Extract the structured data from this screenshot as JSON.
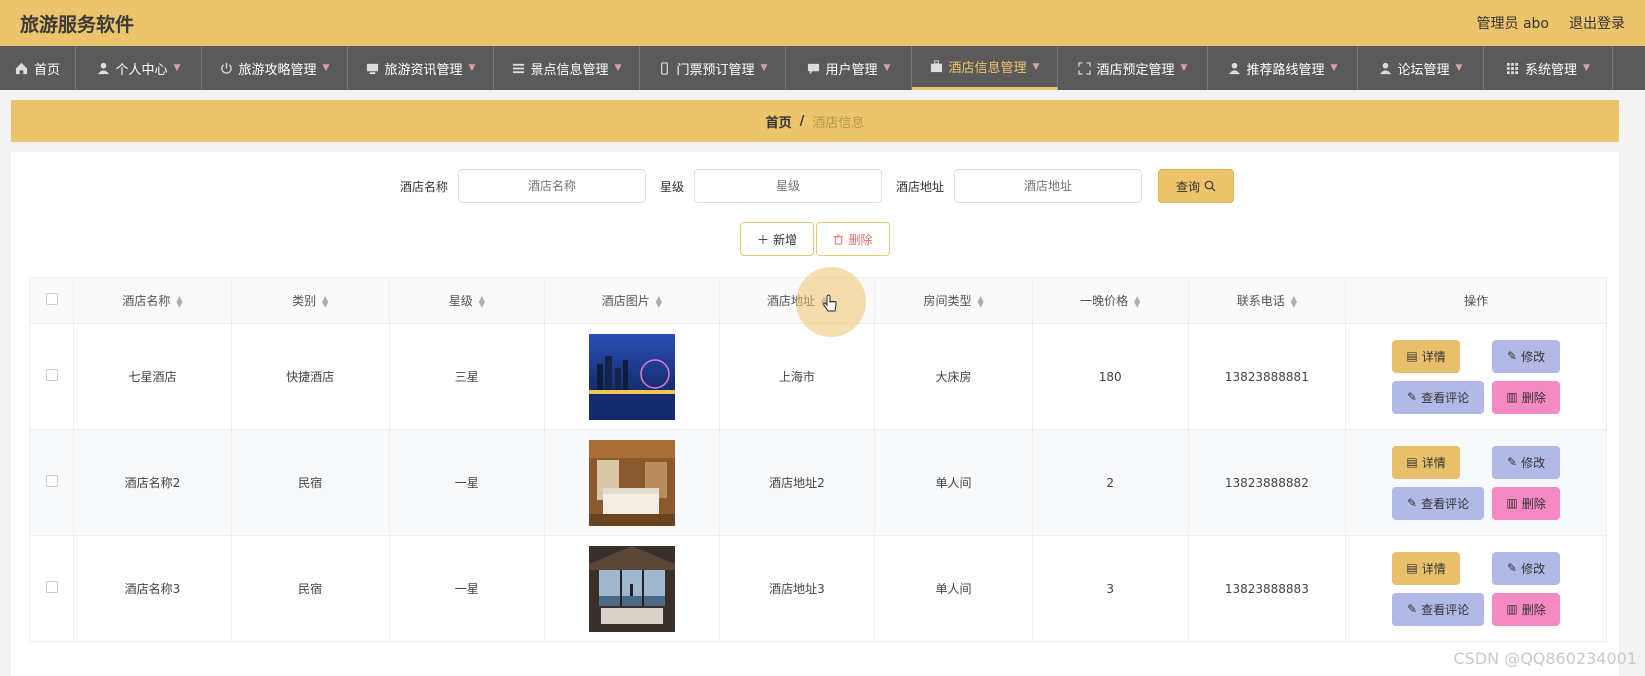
{
  "header": {
    "title": "旅游服务软件",
    "user": "管理员 abo",
    "logout": "退出登录"
  },
  "nav": [
    {
      "label": "首页",
      "icon": "home-icon",
      "width": 76
    },
    {
      "label": "个人中心",
      "icon": "user-icon",
      "width": 126
    },
    {
      "label": "旅游攻略管理",
      "icon": "power-icon",
      "width": 146
    },
    {
      "label": "旅游资讯管理",
      "icon": "monitor-icon",
      "width": 146
    },
    {
      "label": "景点信息管理",
      "icon": "list-icon",
      "width": 146
    },
    {
      "label": "门票预订管理",
      "icon": "phone-icon",
      "width": 146
    },
    {
      "label": "用户管理",
      "icon": "chat-icon",
      "width": 126
    },
    {
      "label": "酒店信息管理",
      "icon": "briefcase-icon",
      "width": 146,
      "active": true
    },
    {
      "label": "酒店预定管理",
      "icon": "fullscreen-icon",
      "width": 150
    },
    {
      "label": "推荐路线管理",
      "icon": "user-icon",
      "width": 150
    },
    {
      "label": "论坛管理",
      "icon": "user-icon",
      "width": 126
    },
    {
      "label": "系统管理",
      "icon": "grid-icon",
      "width": 129
    }
  ],
  "breadcrumb": {
    "home": "首页",
    "separator": "/",
    "current": "酒店信息"
  },
  "search": {
    "name_label": "酒店名称",
    "name_placeholder": "酒店名称",
    "star_label": "星级",
    "star_placeholder": "星级",
    "addr_label": "酒店地址",
    "addr_placeholder": "酒店地址",
    "query_label": "查询"
  },
  "toolbar": {
    "add_label": "新增",
    "delete_label": "删除"
  },
  "table": {
    "columns": [
      "酒店名称",
      "类别",
      "星级",
      "酒店图片",
      "酒店地址",
      "房间类型",
      "一晚价格",
      "联系电话",
      "操作"
    ],
    "rows": [
      {
        "name": "七星酒店",
        "type": "快捷酒店",
        "star": "三星",
        "address": "上海市",
        "room": "大床房",
        "price": "180",
        "phone": "13823888881"
      },
      {
        "name": "酒店名称2",
        "type": "民宿",
        "star": "一星",
        "address": "酒店地址2",
        "room": "单人间",
        "price": "2",
        "phone": "13823888882"
      },
      {
        "name": "酒店名称3",
        "type": "民宿",
        "star": "一星",
        "address": "酒店地址3",
        "room": "单人间",
        "price": "3",
        "phone": "13823888883"
      }
    ],
    "ops": {
      "detail": "详情",
      "edit": "修改",
      "comment": "查看评论",
      "remove": "删除"
    }
  },
  "watermark": "CSDN @QQ860234001",
  "colors": {
    "accent": "#ecc46b",
    "nav_bg": "#5b5a5a",
    "edit": "#b2b9e6",
    "remove": "#f58ac2"
  }
}
